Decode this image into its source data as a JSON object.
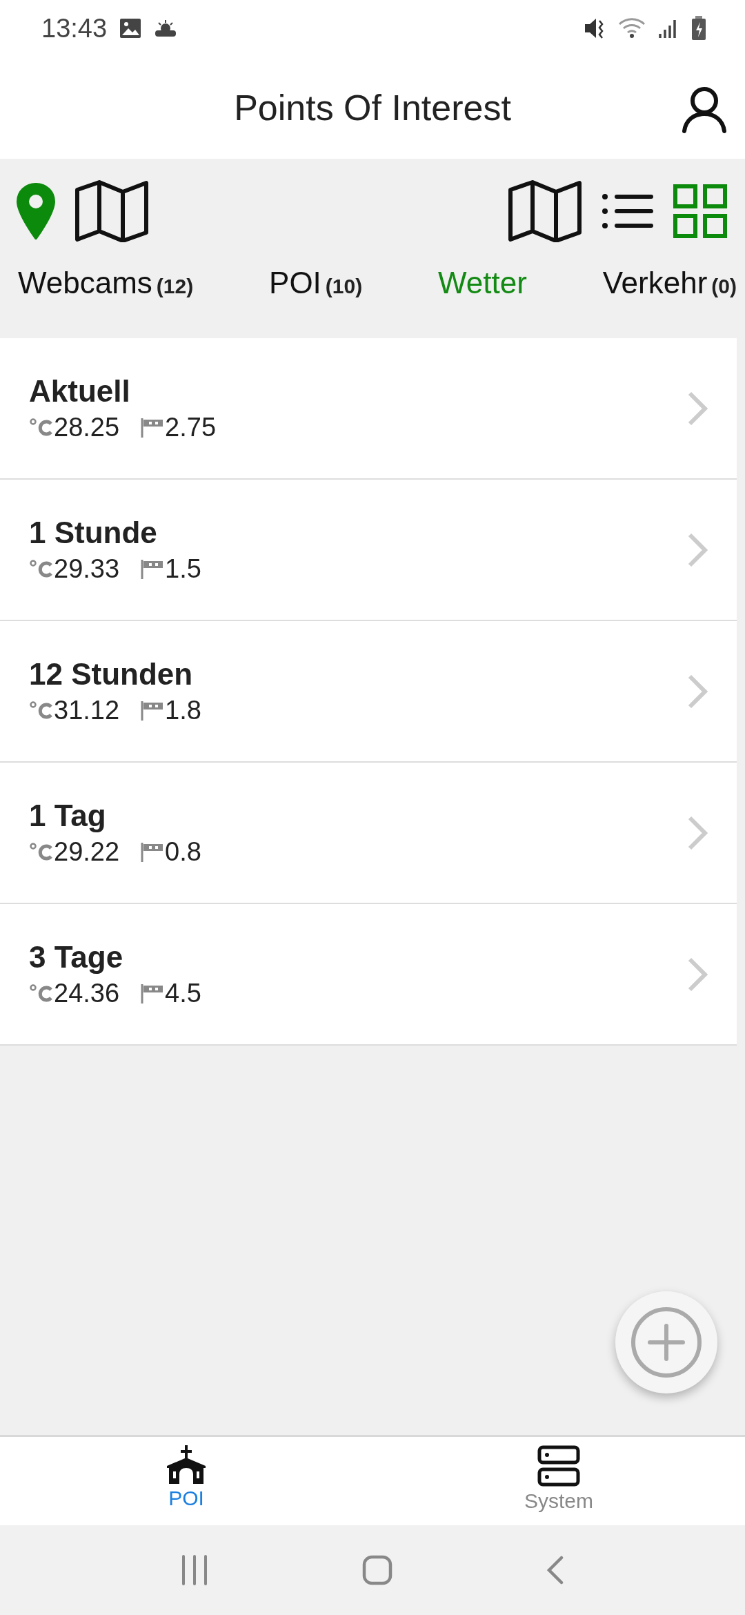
{
  "status_bar": {
    "time": "13:43"
  },
  "header": {
    "title": "Points Of Interest"
  },
  "view_toggles": [
    {
      "kind": "pin",
      "selected": true
    },
    {
      "kind": "map",
      "selected": false
    }
  ],
  "layout_toggles": [
    {
      "kind": "map",
      "selected": false
    },
    {
      "kind": "list",
      "selected": false
    },
    {
      "kind": "grid",
      "selected": true
    }
  ],
  "tabs": [
    {
      "label": "Webcams",
      "count": "(12)",
      "selected": false
    },
    {
      "label": "POI",
      "count": "(10)",
      "selected": false
    },
    {
      "label": "Wetter",
      "selected": true
    },
    {
      "label": "Verkehr",
      "count": "(0)",
      "selected": false
    }
  ],
  "forecasts": [
    {
      "title": "Aktuell",
      "temperature": "28.25",
      "wind": "2.75"
    },
    {
      "title": "1 Stunde",
      "temperature": "29.33",
      "wind": "1.5"
    },
    {
      "title": "12 Stunden",
      "temperature": "31.12",
      "wind": "1.8"
    },
    {
      "title": "1 Tag",
      "temperature": "29.22",
      "wind": "0.8"
    },
    {
      "title": "3 Tage",
      "temperature": "24.36",
      "wind": "4.5"
    }
  ],
  "bottom_nav": [
    {
      "label": "POI",
      "kind": "church",
      "selected": true
    },
    {
      "label": "System",
      "kind": "server",
      "selected": false
    }
  ]
}
